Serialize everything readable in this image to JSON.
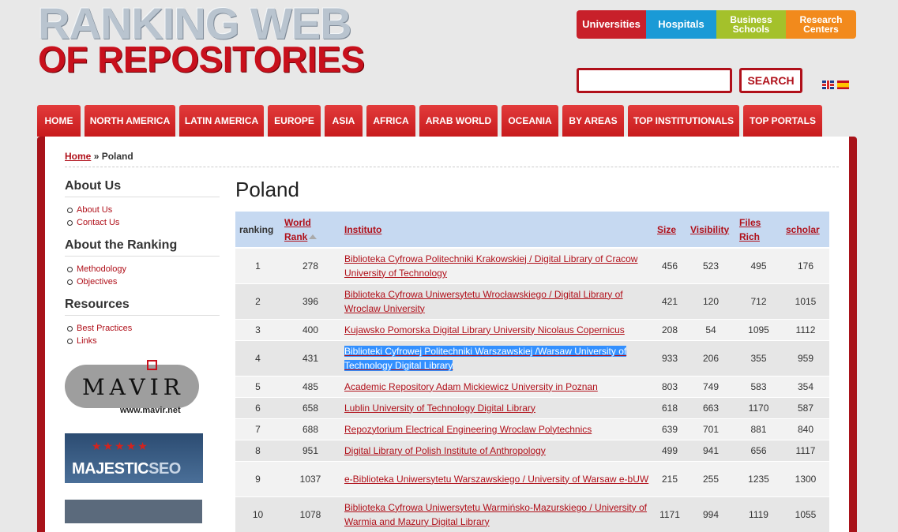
{
  "logo": {
    "line1": "RANKING WEB",
    "line2": "OF REPOSITORIES"
  },
  "topbuttons": [
    {
      "label": "Universities",
      "color": "#c8202a"
    },
    {
      "label": "Hospitals",
      "color": "#1a9ad6"
    },
    {
      "label": "Business Schools",
      "color": "#a4c12b"
    },
    {
      "label": "Research Centers",
      "color": "#f28a1c"
    }
  ],
  "search": {
    "value": "",
    "placeholder": "",
    "button_label": "SEARCH"
  },
  "flags": [
    "english-flag-icon",
    "spanish-flag-icon"
  ],
  "nav": [
    "HOME",
    "NORTH AMERICA",
    "LATIN AMERICA",
    "EUROPE",
    "ASIA",
    "AFRICA",
    "ARAB WORLD",
    "OCEANIA",
    "BY AREAS",
    "TOP INSTITUTIONALS",
    "TOP PORTALS"
  ],
  "breadcrumb": {
    "home": "Home",
    "sep": "»",
    "current": "Poland"
  },
  "sidebar": {
    "sections": [
      {
        "title": "About Us",
        "items": [
          "About Us",
          "Contact Us"
        ]
      },
      {
        "title": "About the Ranking",
        "items": [
          "Methodology",
          "Objectives"
        ]
      },
      {
        "title": "Resources",
        "items": [
          "Best Practices",
          "Links"
        ]
      }
    ],
    "mavir": {
      "text": "MAVIR",
      "url": "www.mavir.net"
    },
    "majestic": {
      "part1": "MAJESTIC",
      "part2": "SEO",
      "stars": "★★★★★"
    }
  },
  "main": {
    "title": "Poland",
    "columns": [
      "ranking",
      "World Rank",
      "Instituto",
      "Size",
      "Visibility",
      "Files Rich",
      "scholar"
    ],
    "rows": [
      {
        "ranking": "1",
        "world": "278",
        "inst": "Biblioteka Cyfrowa Politechniki Krakowskiej / Digital Library of Cracow University of Technology",
        "size": "456",
        "vis": "523",
        "files": "495",
        "scholar": "176"
      },
      {
        "ranking": "2",
        "world": "396",
        "inst": "Biblioteka Cyfrowa Uniwersytetu Wrocławskiego / Digital Library of Wroclaw University",
        "size": "421",
        "vis": "120",
        "files": "712",
        "scholar": "1015"
      },
      {
        "ranking": "3",
        "world": "400",
        "inst": "Kujawsko Pomorska Digital Library University Nicolaus Copernicus",
        "size": "208",
        "vis": "54",
        "files": "1095",
        "scholar": "1112"
      },
      {
        "ranking": "4",
        "world": "431",
        "inst": "Biblioteki Cyfrowej Politechniki Warszawskiej /Warsaw University of Technology Digital Library",
        "size": "933",
        "vis": "206",
        "files": "355",
        "scholar": "959"
      },
      {
        "ranking": "5",
        "world": "485",
        "inst": "Academic Repository Adam Mickiewicz University in Poznan",
        "size": "803",
        "vis": "749",
        "files": "583",
        "scholar": "354"
      },
      {
        "ranking": "6",
        "world": "658",
        "inst": "Lublin University of Technology Digital Library",
        "size": "618",
        "vis": "663",
        "files": "1170",
        "scholar": "587"
      },
      {
        "ranking": "7",
        "world": "688",
        "inst": "Repozytorium Electrical Engineering Wroclaw Polytechnics",
        "size": "639",
        "vis": "701",
        "files": "881",
        "scholar": "840"
      },
      {
        "ranking": "8",
        "world": "951",
        "inst": "Digital Library of Polish Institute of Anthropology",
        "size": "499",
        "vis": "941",
        "files": "656",
        "scholar": "1117"
      },
      {
        "ranking": "9",
        "world": "1037",
        "inst": "e-Biblioteka Uniwersytetu Warszawskiego / University of Warsaw e-bUW",
        "size": "215",
        "vis": "255",
        "files": "1235",
        "scholar": "1300"
      },
      {
        "ranking": "10",
        "world": "1078",
        "inst": "Biblioteka Cyfrowa Uniwersytetu Warmińsko-Mazurskiego / University of Warmia and Mazury Digital Library",
        "size": "1171",
        "vis": "994",
        "files": "1119",
        "scholar": "1055"
      }
    ]
  }
}
